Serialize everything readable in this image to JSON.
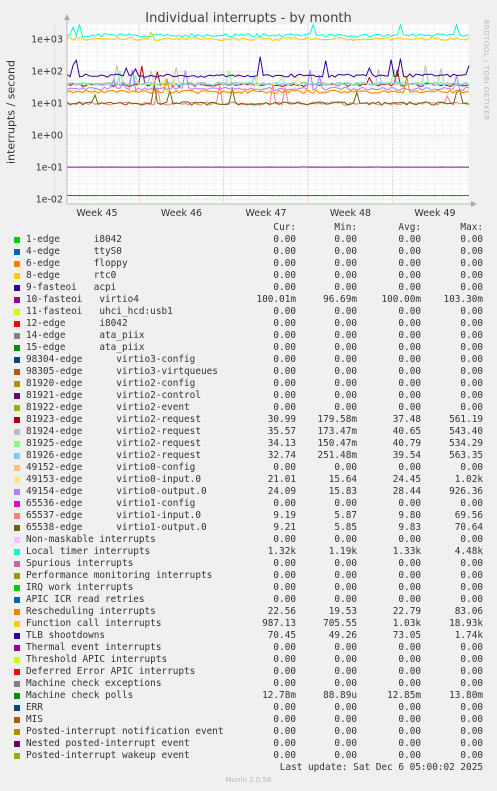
{
  "chart_data": {
    "type": "line",
    "title": "Individual interrupts - by month",
    "ylabel": "interrupts / second",
    "y_scale": "log",
    "ylim": [
      0.007,
      3000
    ],
    "y_ticks": [
      {
        "value": 0.01,
        "label": "1e-02"
      },
      {
        "value": 0.1,
        "label": "1e-01"
      },
      {
        "value": 1,
        "label": "1e+00"
      },
      {
        "value": 10,
        "label": "1e+01"
      },
      {
        "value": 100,
        "label": "1e+02"
      },
      {
        "value": 1000,
        "label": "1e+03"
      }
    ],
    "x_ticks": [
      "Week 45",
      "Week 46",
      "Week 47",
      "Week 48",
      "Week 49"
    ],
    "grid": true,
    "columns": [
      "Cur:",
      "Min:",
      "Avg:",
      "Max:"
    ],
    "series": [
      {
        "name": "1-edge      i8042",
        "color": "#00cc00",
        "cur": "0.00",
        "min": "0.00",
        "avg": "0.00",
        "max": "0.00"
      },
      {
        "name": "4-edge      ttyS0",
        "color": "#0066b3",
        "cur": "0.00",
        "min": "0.00",
        "avg": "0.00",
        "max": "0.00"
      },
      {
        "name": "6-edge      floppy",
        "color": "#ff8000",
        "cur": "0.00",
        "min": "0.00",
        "avg": "0.00",
        "max": "0.00"
      },
      {
        "name": "8-edge      rtc0",
        "color": "#ffcc00",
        "cur": "0.00",
        "min": "0.00",
        "avg": "0.00",
        "max": "0.00"
      },
      {
        "name": "9-fasteoi   acpi",
        "color": "#330099",
        "cur": "0.00",
        "min": "0.00",
        "avg": "0.00",
        "max": "0.00"
      },
      {
        "name": "10-fasteoi   virtio4",
        "color": "#990099",
        "cur": "100.01m",
        "min": "96.69m",
        "avg": "100.00m",
        "max": "103.30m"
      },
      {
        "name": "11-fasteoi   uhci_hcd:usb1",
        "color": "#ccff00",
        "cur": "0.00",
        "min": "0.00",
        "avg": "0.00",
        "max": "0.00"
      },
      {
        "name": "12-edge      i8042",
        "color": "#ff0000",
        "cur": "0.00",
        "min": "0.00",
        "avg": "0.00",
        "max": "0.00"
      },
      {
        "name": "14-edge      ata_piix",
        "color": "#808080",
        "cur": "0.00",
        "min": "0.00",
        "avg": "0.00",
        "max": "0.00"
      },
      {
        "name": "15-edge      ata_piix",
        "color": "#008f00",
        "cur": "0.00",
        "min": "0.00",
        "avg": "0.00",
        "max": "0.00"
      },
      {
        "name": "98304-edge      virtio3-config",
        "color": "#00487d",
        "cur": "0.00",
        "min": "0.00",
        "avg": "0.00",
        "max": "0.00"
      },
      {
        "name": "98305-edge      virtio3-virtqueues",
        "color": "#b35a00",
        "cur": "0.00",
        "min": "0.00",
        "avg": "0.00",
        "max": "0.00"
      },
      {
        "name": "81920-edge      virtio2-config",
        "color": "#b38f00",
        "cur": "0.00",
        "min": "0.00",
        "avg": "0.00",
        "max": "0.00"
      },
      {
        "name": "81921-edge      virtio2-control",
        "color": "#6b006b",
        "cur": "0.00",
        "min": "0.00",
        "avg": "0.00",
        "max": "0.00"
      },
      {
        "name": "81922-edge      virtio2-event",
        "color": "#8fb300",
        "cur": "0.00",
        "min": "0.00",
        "avg": "0.00",
        "max": "0.00"
      },
      {
        "name": "81923-edge      virtio2-request",
        "color": "#b30000",
        "cur": "30.99",
        "min": "179.58m",
        "avg": "37.48",
        "max": "561.19"
      },
      {
        "name": "81924-edge      virtio2-request",
        "color": "#bebebe",
        "cur": "35.57",
        "min": "173.47m",
        "avg": "40.65",
        "max": "543.40"
      },
      {
        "name": "81925-edge      virtio2-request",
        "color": "#80ff80",
        "cur": "34.13",
        "min": "150.47m",
        "avg": "40.79",
        "max": "534.29"
      },
      {
        "name": "81926-edge      virtio2-request",
        "color": "#80c9ff",
        "cur": "32.74",
        "min": "251.48m",
        "avg": "39.54",
        "max": "563.35"
      },
      {
        "name": "49152-edge      virtio0-config",
        "color": "#ffc080",
        "cur": "0.00",
        "min": "0.00",
        "avg": "0.00",
        "max": "0.00"
      },
      {
        "name": "49153-edge      virtio0-input.0",
        "color": "#ffe680",
        "cur": "21.01",
        "min": "15.64",
        "avg": "24.45",
        "max": "1.02k"
      },
      {
        "name": "49154-edge      virtio0-output.0",
        "color": "#aa80ff",
        "cur": "24.09",
        "min": "15.83",
        "avg": "28.44",
        "max": "926.36"
      },
      {
        "name": "65536-edge      virtio1-config",
        "color": "#ee00cc",
        "cur": "0.00",
        "min": "0.00",
        "avg": "0.00",
        "max": "0.00"
      },
      {
        "name": "65537-edge      virtio1-input.0",
        "color": "#ff8080",
        "cur": "9.19",
        "min": "5.87",
        "avg": "9.80",
        "max": "69.56"
      },
      {
        "name": "65538-edge      virtio1-output.0",
        "color": "#666600",
        "cur": "9.21",
        "min": "5.85",
        "avg": "9.83",
        "max": "70.64"
      },
      {
        "name": "Non-maskable interrupts",
        "color": "#ffbfff",
        "cur": "0.00",
        "min": "0.00",
        "avg": "0.00",
        "max": "0.00"
      },
      {
        "name": "Local timer interrupts",
        "color": "#00ffcc",
        "cur": "1.32k",
        "min": "1.19k",
        "avg": "1.33k",
        "max": "4.48k"
      },
      {
        "name": "Spurious interrupts",
        "color": "#cc6699",
        "cur": "0.00",
        "min": "0.00",
        "avg": "0.00",
        "max": "0.00"
      },
      {
        "name": "Performance monitoring interrupts",
        "color": "#999900",
        "cur": "0.00",
        "min": "0.00",
        "avg": "0.00",
        "max": "0.00"
      },
      {
        "name": "IRQ work interrupts",
        "color": "#00cc00",
        "cur": "0.00",
        "min": "0.00",
        "avg": "0.00",
        "max": "0.00"
      },
      {
        "name": "APIC ICR read retries",
        "color": "#0066b3",
        "cur": "0.00",
        "min": "0.00",
        "avg": "0.00",
        "max": "0.00"
      },
      {
        "name": "Rescheduling interrupts",
        "color": "#ff8000",
        "cur": "22.56",
        "min": "19.53",
        "avg": "22.79",
        "max": "83.06"
      },
      {
        "name": "Function call interrupts",
        "color": "#ffcc00",
        "cur": "987.13",
        "min": "705.55",
        "avg": "1.03k",
        "max": "18.93k"
      },
      {
        "name": "TLB shootdowns",
        "color": "#330099",
        "cur": "70.45",
        "min": "49.26",
        "avg": "73.05",
        "max": "1.74k"
      },
      {
        "name": "Thermal event interrupts",
        "color": "#990099",
        "cur": "0.00",
        "min": "0.00",
        "avg": "0.00",
        "max": "0.00"
      },
      {
        "name": "Threshold APIC interrupts",
        "color": "#ccff00",
        "cur": "0.00",
        "min": "0.00",
        "avg": "0.00",
        "max": "0.00"
      },
      {
        "name": "Deferred Error APIC interrupts",
        "color": "#ff0000",
        "cur": "0.00",
        "min": "0.00",
        "avg": "0.00",
        "max": "0.00"
      },
      {
        "name": "Machine check exceptions",
        "color": "#808080",
        "cur": "0.00",
        "min": "0.00",
        "avg": "0.00",
        "max": "0.00"
      },
      {
        "name": "Machine check polls",
        "color": "#008f00",
        "cur": "12.78m",
        "min": "88.89u",
        "avg": "12.85m",
        "max": "13.80m"
      },
      {
        "name": "ERR",
        "color": "#00487d",
        "cur": "0.00",
        "min": "0.00",
        "avg": "0.00",
        "max": "0.00"
      },
      {
        "name": "MIS",
        "color": "#b35a00",
        "cur": "0.00",
        "min": "0.00",
        "avg": "0.00",
        "max": "0.00"
      },
      {
        "name": "Posted-interrupt notification event",
        "color": "#b38f00",
        "cur": "0.00",
        "min": "0.00",
        "avg": "0.00",
        "max": "0.00"
      },
      {
        "name": "Nested posted-interrupt event",
        "color": "#6b006b",
        "cur": "0.00",
        "min": "0.00",
        "avg": "0.00",
        "max": "0.00"
      },
      {
        "name": "Posted-interrupt wakeup event",
        "color": "#8fb300",
        "cur": "0.00",
        "min": "0.00",
        "avg": "0.00",
        "max": "0.00"
      }
    ]
  },
  "last_update": "Last update: Sat Dec  6 05:00:02 2025",
  "footer": "Munin 2.0.56",
  "watermark": "RRDTOOL / TOBI OETIKER"
}
